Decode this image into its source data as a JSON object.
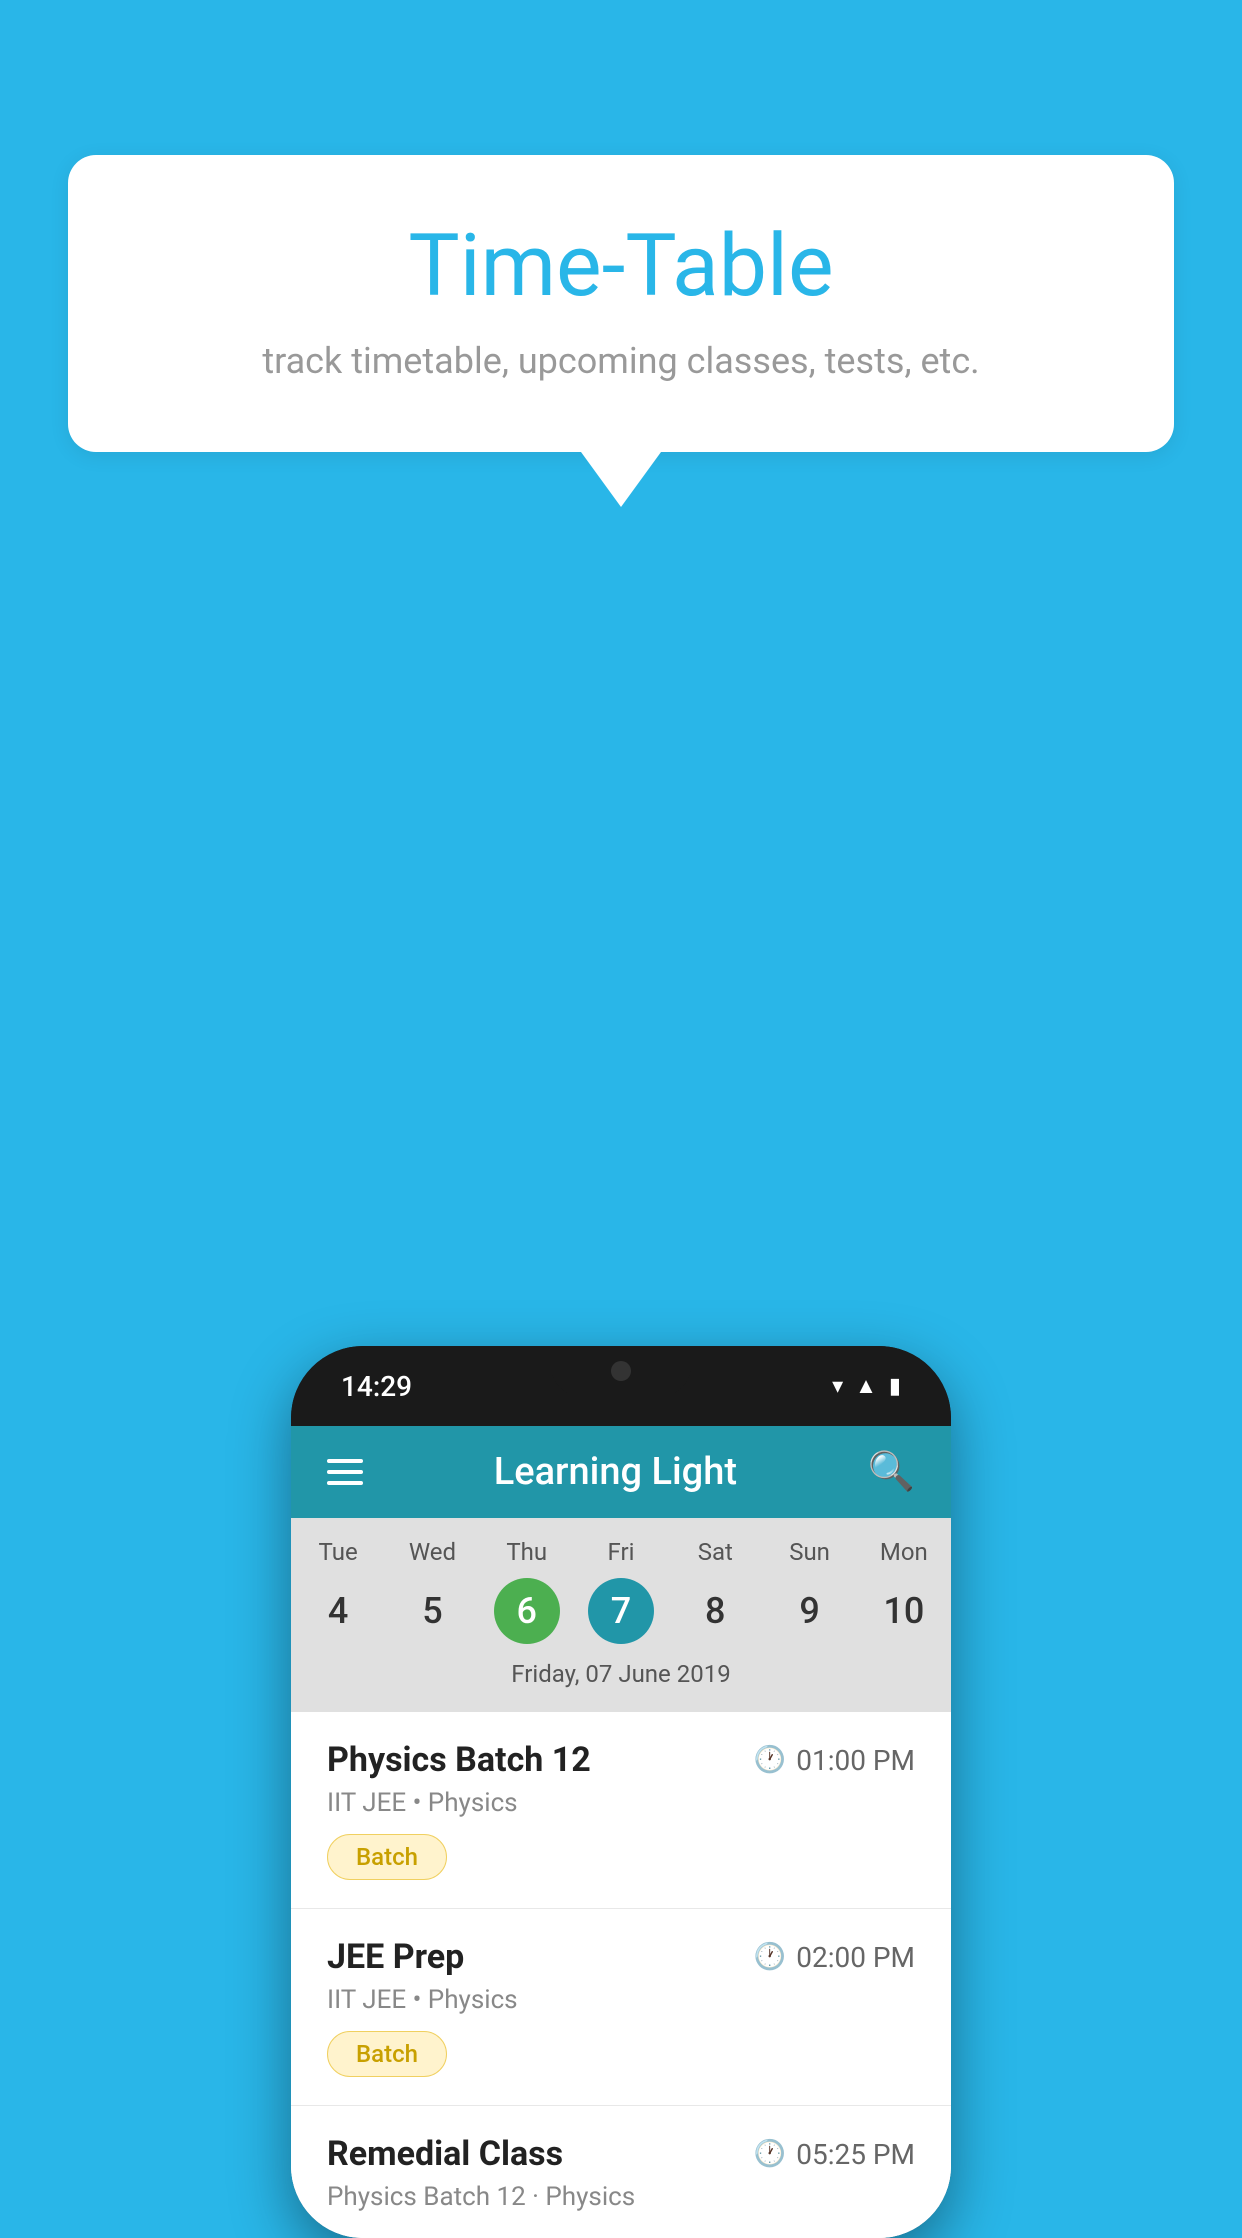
{
  "background_color": "#29b6e8",
  "speech_bubble": {
    "title": "Time-Table",
    "subtitle": "track timetable, upcoming classes, tests, etc."
  },
  "phone": {
    "status_bar": {
      "time": "14:29"
    },
    "app_header": {
      "title": "Learning Light"
    },
    "calendar": {
      "days": [
        "Tue",
        "Wed",
        "Thu",
        "Fri",
        "Sat",
        "Sun",
        "Mon"
      ],
      "dates": [
        "4",
        "5",
        "6",
        "7",
        "8",
        "9",
        "10"
      ],
      "today_index": 2,
      "selected_index": 3,
      "selected_date_label": "Friday, 07 June 2019"
    },
    "schedule": [
      {
        "title": "Physics Batch 12",
        "time": "01:00 PM",
        "sub": "IIT JEE • Physics",
        "badge": "Batch"
      },
      {
        "title": "JEE Prep",
        "time": "02:00 PM",
        "sub": "IIT JEE • Physics",
        "badge": "Batch"
      },
      {
        "title": "Remedial Class",
        "time": "05:25 PM",
        "sub": "Physics Batch 12 · Physics",
        "badge": null
      }
    ]
  }
}
